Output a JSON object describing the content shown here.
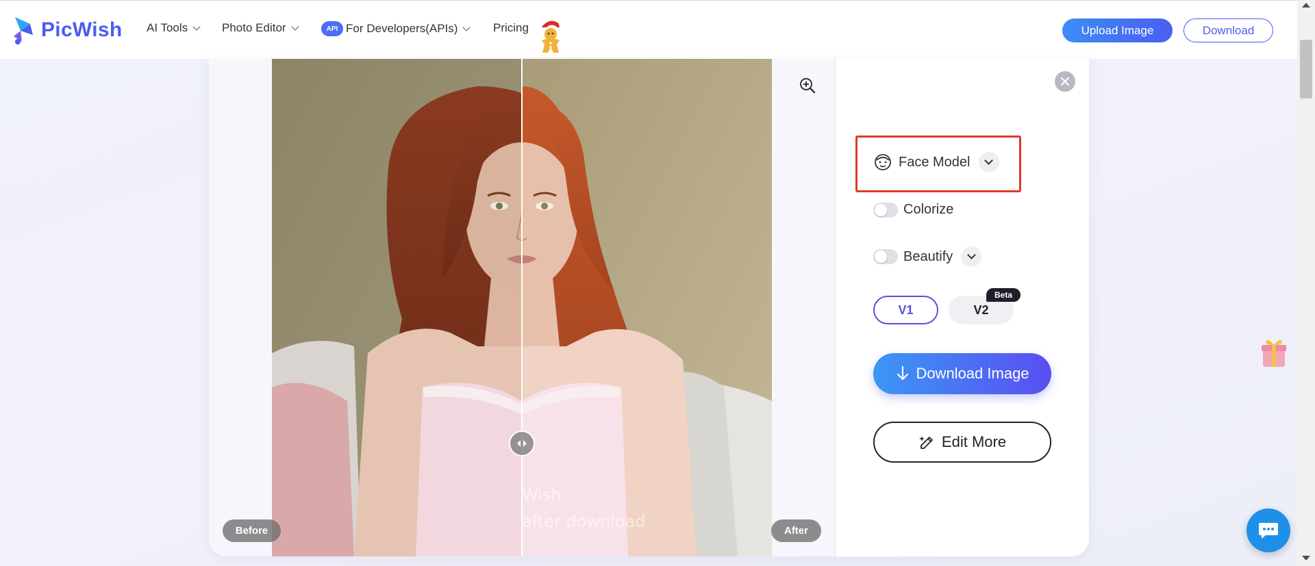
{
  "header": {
    "brand": "PicWish",
    "nav": [
      {
        "label": "AI Tools"
      },
      {
        "label": "Photo Editor"
      },
      {
        "label": "For Developers(APIs)",
        "badge": "API"
      },
      {
        "label": "Pricing"
      }
    ],
    "upload_label": "Upload Image",
    "download_label": "Download"
  },
  "viewer": {
    "before_label": "Before",
    "after_label": "After",
    "watermark_line1": "Wish",
    "watermark_line2": "after download"
  },
  "panel": {
    "face_model_label": "Face Model",
    "colorize_label": "Colorize",
    "colorize_on": false,
    "beautify_label": "Beautify",
    "beautify_on": false,
    "version_v1": "V1",
    "version_v2": "V2",
    "beta_label": "Beta",
    "selected_version": "V1",
    "download_image_label": "Download Image",
    "edit_more_label": "Edit More"
  },
  "colors": {
    "brand": "#4a5cf0",
    "accent_gradient_start": "#3c97f4",
    "accent_gradient_end": "#5a4ef2",
    "highlight_box": "#e0382b",
    "chat": "#1e90e8"
  },
  "icons": [
    "picwish-logo-icon",
    "gingerbread-icon",
    "zoom-in-icon",
    "close-icon",
    "face-icon",
    "download-arrow-icon",
    "magic-pen-icon",
    "gift-icon",
    "chat-icon",
    "compare-handle-icon"
  ]
}
